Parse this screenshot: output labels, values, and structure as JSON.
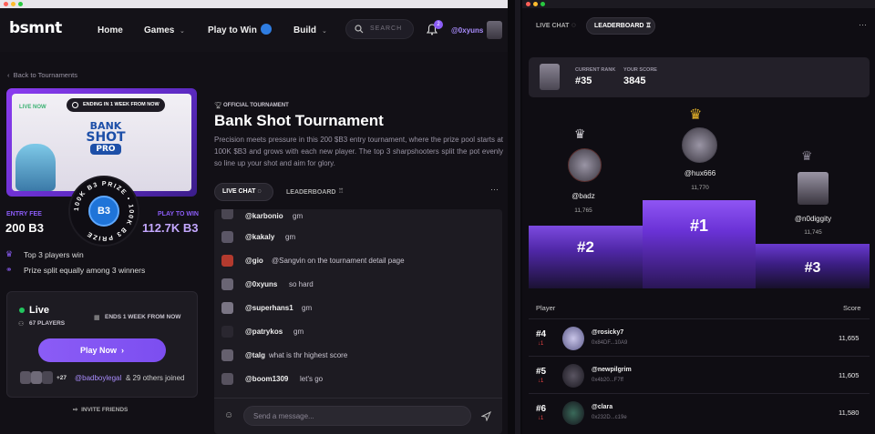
{
  "left": {
    "logo": "bsmnt",
    "nav": [
      "Home",
      "Games",
      "Play to Win",
      "Build"
    ],
    "search_placeholder": "SEARCH",
    "notif_count": "2",
    "username": "@0xyuns",
    "back": "Back to Tournaments",
    "hero": {
      "live_now": "LIVE NOW",
      "ending": "ENDING IN 1 WEEK FROM NOW",
      "game_title_1": "BANK",
      "game_title_2": "SHOT",
      "game_title_3": "PRO"
    },
    "badge": {
      "ring_text": "100K B3 PRIZE • 100K B3 PRIZE",
      "center": "B3"
    },
    "entry_fee_label": "ENTRY FEE",
    "entry_fee": "200 B3",
    "play_to_win_label": "PLAY TO WIN",
    "play_to_win": "112.7K B3",
    "perks": [
      "Top 3 players win",
      "Prize split equally among 3 winners"
    ],
    "status": "Live",
    "players": "67 PLAYERS",
    "ends": "ENDS 1 WEEK FROM NOW",
    "play_now": "Play Now",
    "joined_count": "+27",
    "joined_user": "@badboylegal",
    "joined_rest": "& 29 others joined",
    "invite": "INVITE FRIENDS",
    "official": "OFFICIAL TOURNAMENT",
    "title": "Bank Shot Tournament",
    "desc": "Precision meets pressure in this 200 $B3 entry tournament, where the prize pool starts at 100K $B3 and grows with each new player. The top 3 sharpshooters split the pot evenly so line up your shot and aim for glory.",
    "tabs": [
      "LIVE CHAT",
      "LEADERBOARD"
    ],
    "messages": [
      {
        "user": "@karbonio",
        "text": "gm"
      },
      {
        "user": "@kakaly",
        "text": "gm"
      },
      {
        "user": "@gio",
        "text": "@Sangvin on the tournament detail page"
      },
      {
        "user": "@0xyuns",
        "text": "so hard"
      },
      {
        "user": "@superhans1",
        "text": "gm"
      },
      {
        "user": "@patrykos",
        "text": "gm"
      },
      {
        "user": "@talg",
        "text": "what is thr highest score"
      },
      {
        "user": "@boom1309",
        "text": "let's go"
      }
    ],
    "message_placeholder": "Send a message..."
  },
  "right": {
    "tabs": [
      "LIVE CHAT",
      "LEADERBOARD"
    ],
    "current_rank_label": "CURRENT RANK",
    "current_rank": "#35",
    "your_score_label": "YOUR SCORE",
    "your_score": "3845",
    "podium": [
      {
        "place": "#1",
        "user": "@hux666",
        "score": "11,770"
      },
      {
        "place": "#2",
        "user": "@badz",
        "score": "11,765"
      },
      {
        "place": "#3",
        "user": "@n0diggity",
        "score": "11,745"
      }
    ],
    "col_player": "Player",
    "col_score": "Score",
    "rows": [
      {
        "rank": "#4",
        "change": "↓1",
        "user": "@rosicky7",
        "addr": "0x84DF...10A9",
        "score": "11,655"
      },
      {
        "rank": "#5",
        "change": "↓1",
        "user": "@newpilgrim",
        "addr": "0x4b20...F7ff",
        "score": "11,605"
      },
      {
        "rank": "#6",
        "change": "↓1",
        "user": "@clara",
        "addr": "0x232D...c19e",
        "score": "11,580"
      }
    ]
  },
  "colors": {
    "accent": "#8b5cf6",
    "live": "#22c55e",
    "down": "#ef4444"
  }
}
